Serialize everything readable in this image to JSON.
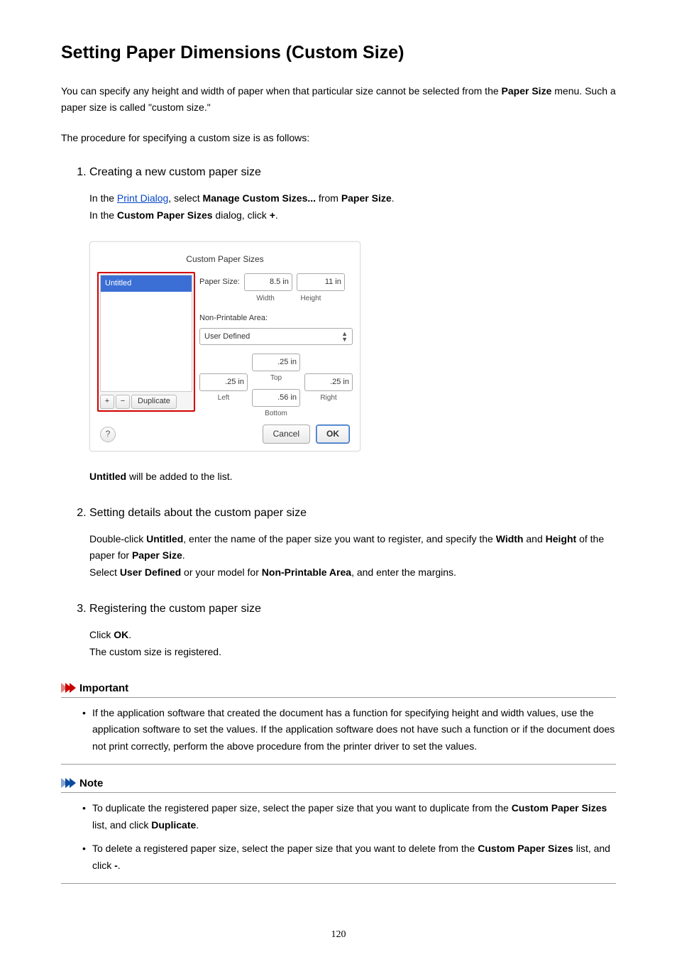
{
  "heading": "Setting Paper Dimensions (Custom Size)",
  "intro": {
    "p1a": "You can specify any height and width of paper when that particular size cannot be selected from the ",
    "p1b": "Paper Size",
    "p1c": " menu. Such a paper size is called \"custom size.\"",
    "p2": "The procedure for specifying a custom size is as follows:"
  },
  "steps": {
    "s1": {
      "title": "Creating a new custom paper size",
      "l1a": "In the ",
      "link": "Print Dialog",
      "l1b": ", select ",
      "l1c": "Manage Custom Sizes...",
      "l1d": " from ",
      "l1e": "Paper Size",
      "l1f": ".",
      "l2a": "In the ",
      "l2b": "Custom Paper Sizes",
      "l2c": " dialog, click ",
      "l2d": "+",
      "l2e": ".",
      "after_a": "Untitled",
      "after_b": " will be added to the list."
    },
    "s2": {
      "title": "Setting details about the custom paper size",
      "l1": "Double-click ",
      "l1b": "Untitled",
      "l1c": ", enter the name of the paper size you want to register, and specify the ",
      "l1d": "Width",
      "l1e": " and ",
      "l1f": "Height",
      "l1g": " of the paper for ",
      "l1h": "Paper Size",
      "l1i": ".",
      "l2a": "Select ",
      "l2b": "User Defined",
      "l2c": " or your model for ",
      "l2d": "Non-Printable Area",
      "l2e": ", and enter the margins."
    },
    "s3": {
      "title": "Registering the custom paper size",
      "l1a": "Click ",
      "l1b": "OK",
      "l1c": ".",
      "l2": "The custom size is registered."
    }
  },
  "dialog": {
    "title": "Custom Paper Sizes",
    "selected": "Untitled",
    "plus": "+",
    "minus": "−",
    "duplicate": "Duplicate",
    "paperSizeLabel": "Paper Size:",
    "width": "8.5 in",
    "height": "11 in",
    "widthLabel": "Width",
    "heightLabel": "Height",
    "npaLabel": "Non-Printable Area:",
    "npaSelect": "User Defined",
    "mTop": ".25 in",
    "mLeft": ".25 in",
    "mRight": ".25 in",
    "mBottom": ".56 in",
    "lblTop": "Top",
    "lblLeft": "Left",
    "lblRight": "Right",
    "lblBottom": "Bottom",
    "help": "?",
    "cancel": "Cancel",
    "ok": "OK"
  },
  "important": {
    "title": "Important",
    "item": "If the application software that created the document has a function for specifying height and width values, use the application software to set the values. If the application software does not have such a function or if the document does not print correctly, perform the above procedure from the printer driver to set the values."
  },
  "note": {
    "title": "Note",
    "i1a": "To duplicate the registered paper size, select the paper size that you want to duplicate from the ",
    "i1b": "Custom Paper Sizes",
    "i1c": " list, and click ",
    "i1d": "Duplicate",
    "i1e": ".",
    "i2a": "To delete a registered paper size, select the paper size that you want to delete from the ",
    "i2b": "Custom Paper Sizes",
    "i2c": " list, and click ",
    "i2d": "-",
    "i2e": "."
  },
  "pageNumber": "120"
}
